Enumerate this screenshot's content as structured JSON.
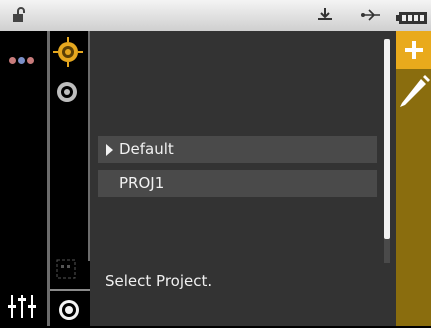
{
  "statusbar": {
    "icons": [
      "unlock-icon",
      "tray-download-icon",
      "usb-icon",
      "battery-icon"
    ]
  },
  "leftrail": {
    "indicator_dot_colors": [
      "#c77b7b",
      "#7b8fc7",
      "#c77b7b"
    ],
    "settings_icon": "sliders-icon"
  },
  "toolcol": {
    "tools": [
      "target-icon",
      "lens-icon"
    ],
    "small_icon": "selection-icon",
    "measure_icon": "measure-ring-icon"
  },
  "main": {
    "items": [
      {
        "label": "Default",
        "selected": true
      },
      {
        "label": "PROJ1",
        "selected": false
      }
    ],
    "status": "Select Project."
  },
  "rightrail": {
    "add_icon": "plus-icon",
    "edit_icon": "pencil-icon"
  },
  "colors": {
    "accent": "#e9aa1c",
    "rail": "#8a6d0e",
    "panel": "#333333",
    "item_bg": "#4a4a4a",
    "target": "#e5a71f"
  }
}
